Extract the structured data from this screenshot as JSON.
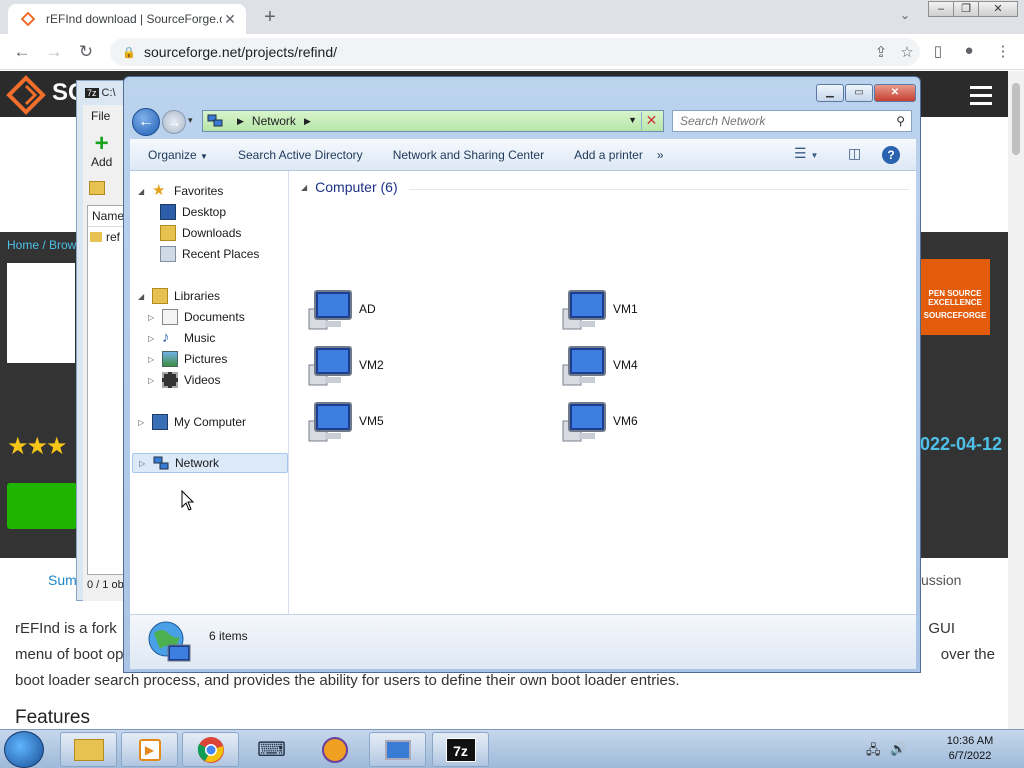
{
  "browser": {
    "tab_title": "rEFInd download | SourceForge.c",
    "url": "sourceforge.net/projects/refind/"
  },
  "sourceforge": {
    "logo_text": "SC",
    "breadcrumb": "Home / Brow",
    "date": "022-04-12",
    "badge_line1": "PEN SOURCE",
    "badge_line2": "EXCELLENCE",
    "badge_line3": "SOURCEFORGE",
    "tab_left": "Sum",
    "tab_right": "ussion",
    "desc_line1_left": "rEFInd is a fork",
    "desc_line1_right": "GUI",
    "desc_line2_left": "menu of boot op",
    "desc_line2_right": "over the",
    "desc_line3": "boot loader search process, and provides the ability for users to define their own boot loader entries.",
    "features": "Features"
  },
  "sevenzip": {
    "title": "C:\\",
    "menu_file": "File",
    "add_label": "Add",
    "col_name": "Name",
    "row_name": "ref",
    "status": "0 / 1 ob"
  },
  "explorer": {
    "address_crumb": "Network",
    "search_placeholder": "Search Network",
    "commands": [
      "Organize",
      "Search Active Directory",
      "Network and Sharing Center",
      "Add a printer"
    ],
    "nav": {
      "favorites": "Favorites",
      "desktop": "Desktop",
      "downloads": "Downloads",
      "recent_places": "Recent Places",
      "libraries": "Libraries",
      "documents": "Documents",
      "music": "Music",
      "pictures": "Pictures",
      "videos": "Videos",
      "my_computer": "My Computer",
      "network": "Network"
    },
    "group_header": "Computer (6)",
    "computers": [
      "AD",
      "VM1",
      "VM2",
      "VM4",
      "VM5",
      "VM6"
    ],
    "status_text": "6 items"
  },
  "taskbar": {
    "time": "10:36 AM",
    "date": "6/7/2022"
  }
}
